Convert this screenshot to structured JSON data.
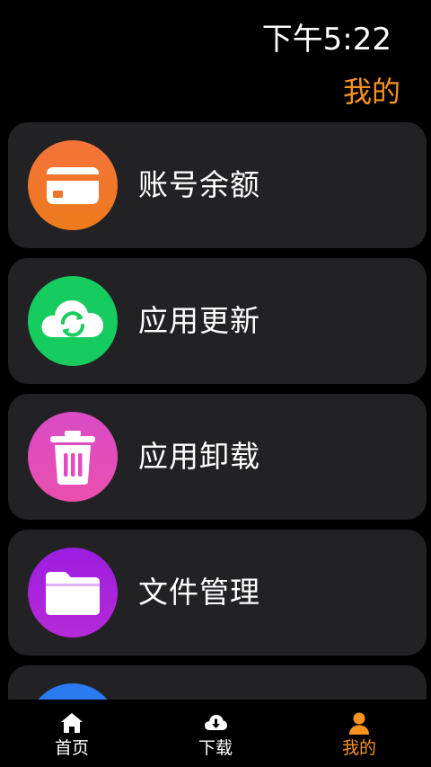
{
  "status_bar": {
    "time": "下午5:22"
  },
  "header": {
    "title": "我的"
  },
  "menu": {
    "items": [
      {
        "label": "账号余额",
        "icon": "card-icon",
        "color": "#f26f2d"
      },
      {
        "label": "应用更新",
        "icon": "cloud-sync-icon",
        "color": "#16cc5e"
      },
      {
        "label": "应用卸载",
        "icon": "trash-icon",
        "color": "#e24bbf"
      },
      {
        "label": "文件管理",
        "icon": "folder-icon",
        "color": "#a61fe0"
      },
      {
        "label": "",
        "icon": "partial-item-icon",
        "color": "#2a7bf0"
      }
    ]
  },
  "tabbar": {
    "tabs": [
      {
        "label": "首页",
        "icon": "home-icon",
        "active": false
      },
      {
        "label": "下载",
        "icon": "download-cloud-icon",
        "active": false
      },
      {
        "label": "我的",
        "icon": "person-icon",
        "active": true
      }
    ],
    "active_color": "#f7931e"
  }
}
